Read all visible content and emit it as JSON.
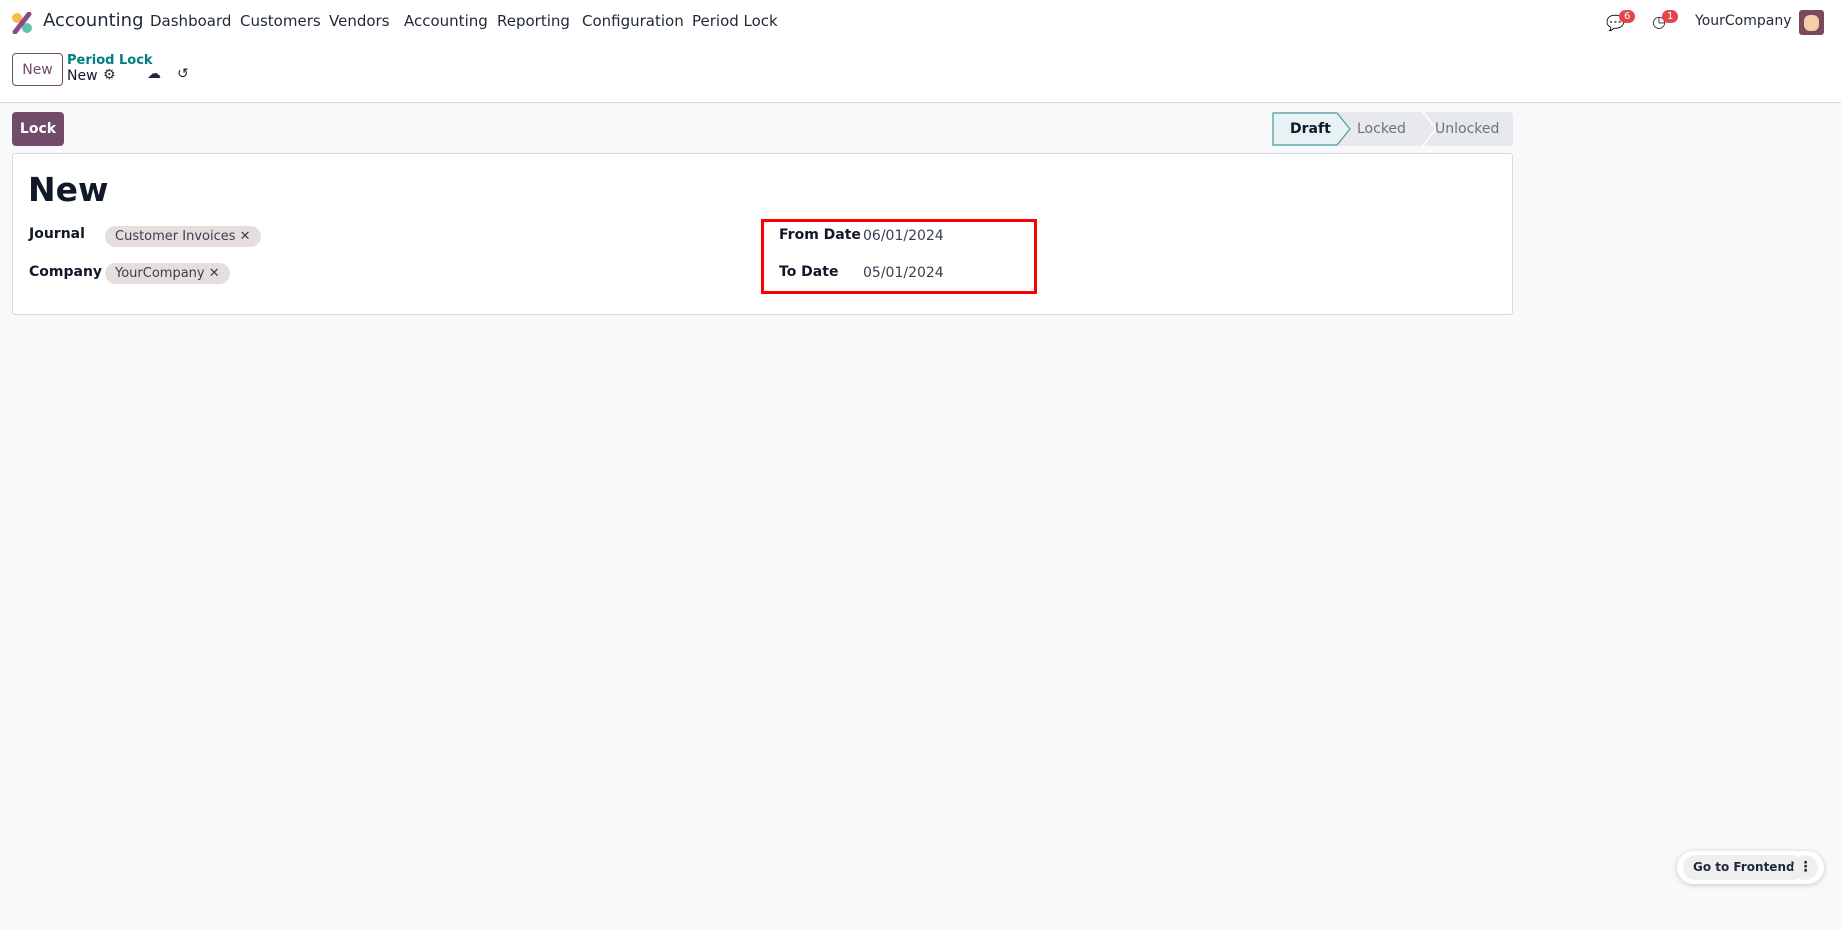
{
  "navbar": {
    "app_name": "Accounting",
    "menu": [
      "Dashboard",
      "Customers",
      "Vendors",
      "Accounting",
      "Reporting",
      "Configuration",
      "Period Lock"
    ],
    "messages_count": "6",
    "activities_count": "1",
    "company": "YourCompany"
  },
  "control_panel": {
    "new_label": "New",
    "breadcrumb_parent": "Period Lock",
    "breadcrumb_current": "New"
  },
  "actions": {
    "lock_label": "Lock"
  },
  "statusbar": {
    "stages": [
      "Draft",
      "Locked",
      "Unlocked"
    ],
    "active": "Draft"
  },
  "form": {
    "title": "New",
    "journal_label": "Journal",
    "journal_tag": "Customer Invoices",
    "company_label": "Company",
    "company_tag": "YourCompany",
    "from_date_label": "From Date",
    "from_date": "06/01/2024",
    "to_date_label": "To Date",
    "to_date": "05/01/2024"
  },
  "footer": {
    "go_frontend": "Go to Frontend"
  },
  "colors": {
    "brand": "#714b67",
    "highlight": "#ff0000",
    "active_stage": "#e6f2f3"
  }
}
